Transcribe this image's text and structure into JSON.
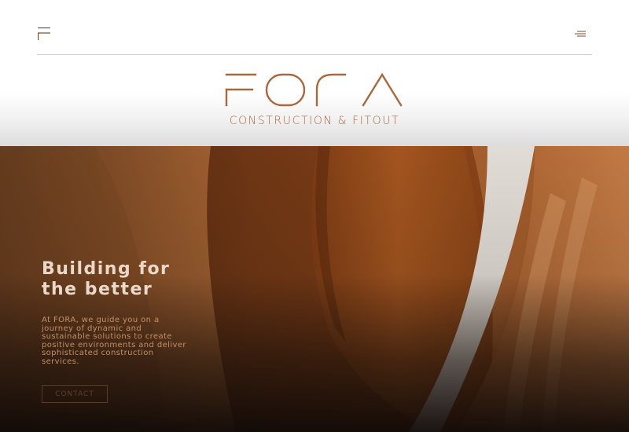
{
  "header": {
    "corner_logo_icon": "fora-mark-icon",
    "menu_icon": "menu-lines-icon"
  },
  "brand": {
    "name": "FORA",
    "tagline": "CONSTRUCTION & FITOUT",
    "color": "#a8683c"
  },
  "hero": {
    "title": "Building for\nthe better",
    "description": "At FORA, we guide you on a journey of dynamic and sustainable solutions to create positive environments and deliver sophisticated construction services.",
    "cta_label": "CONTACT",
    "title_color": "#ead8c8",
    "text_color": "#c58f67"
  }
}
